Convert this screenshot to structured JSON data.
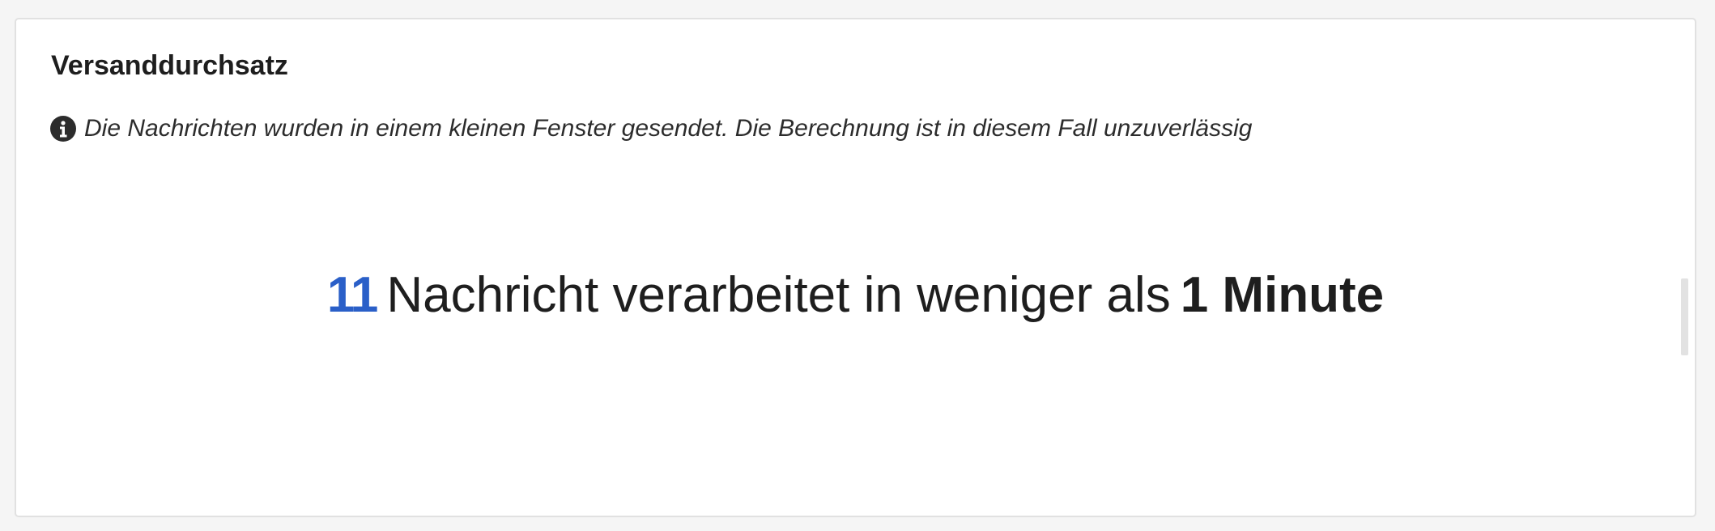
{
  "card": {
    "title": "Versanddurchsatz",
    "info": {
      "icon": "info-icon",
      "message": "Die Nachrichten wurden in einem kleinen Fenster gesendet. Die Berechnung ist in diesem Fall unzuverlässig"
    },
    "metric": {
      "count": "11",
      "label": "Nachricht verarbeitet in weniger als",
      "duration": "1 Minute"
    }
  },
  "colors": {
    "accent": "#2a5fc8",
    "text": "#1e1e1e",
    "border": "#e1e1e1"
  }
}
